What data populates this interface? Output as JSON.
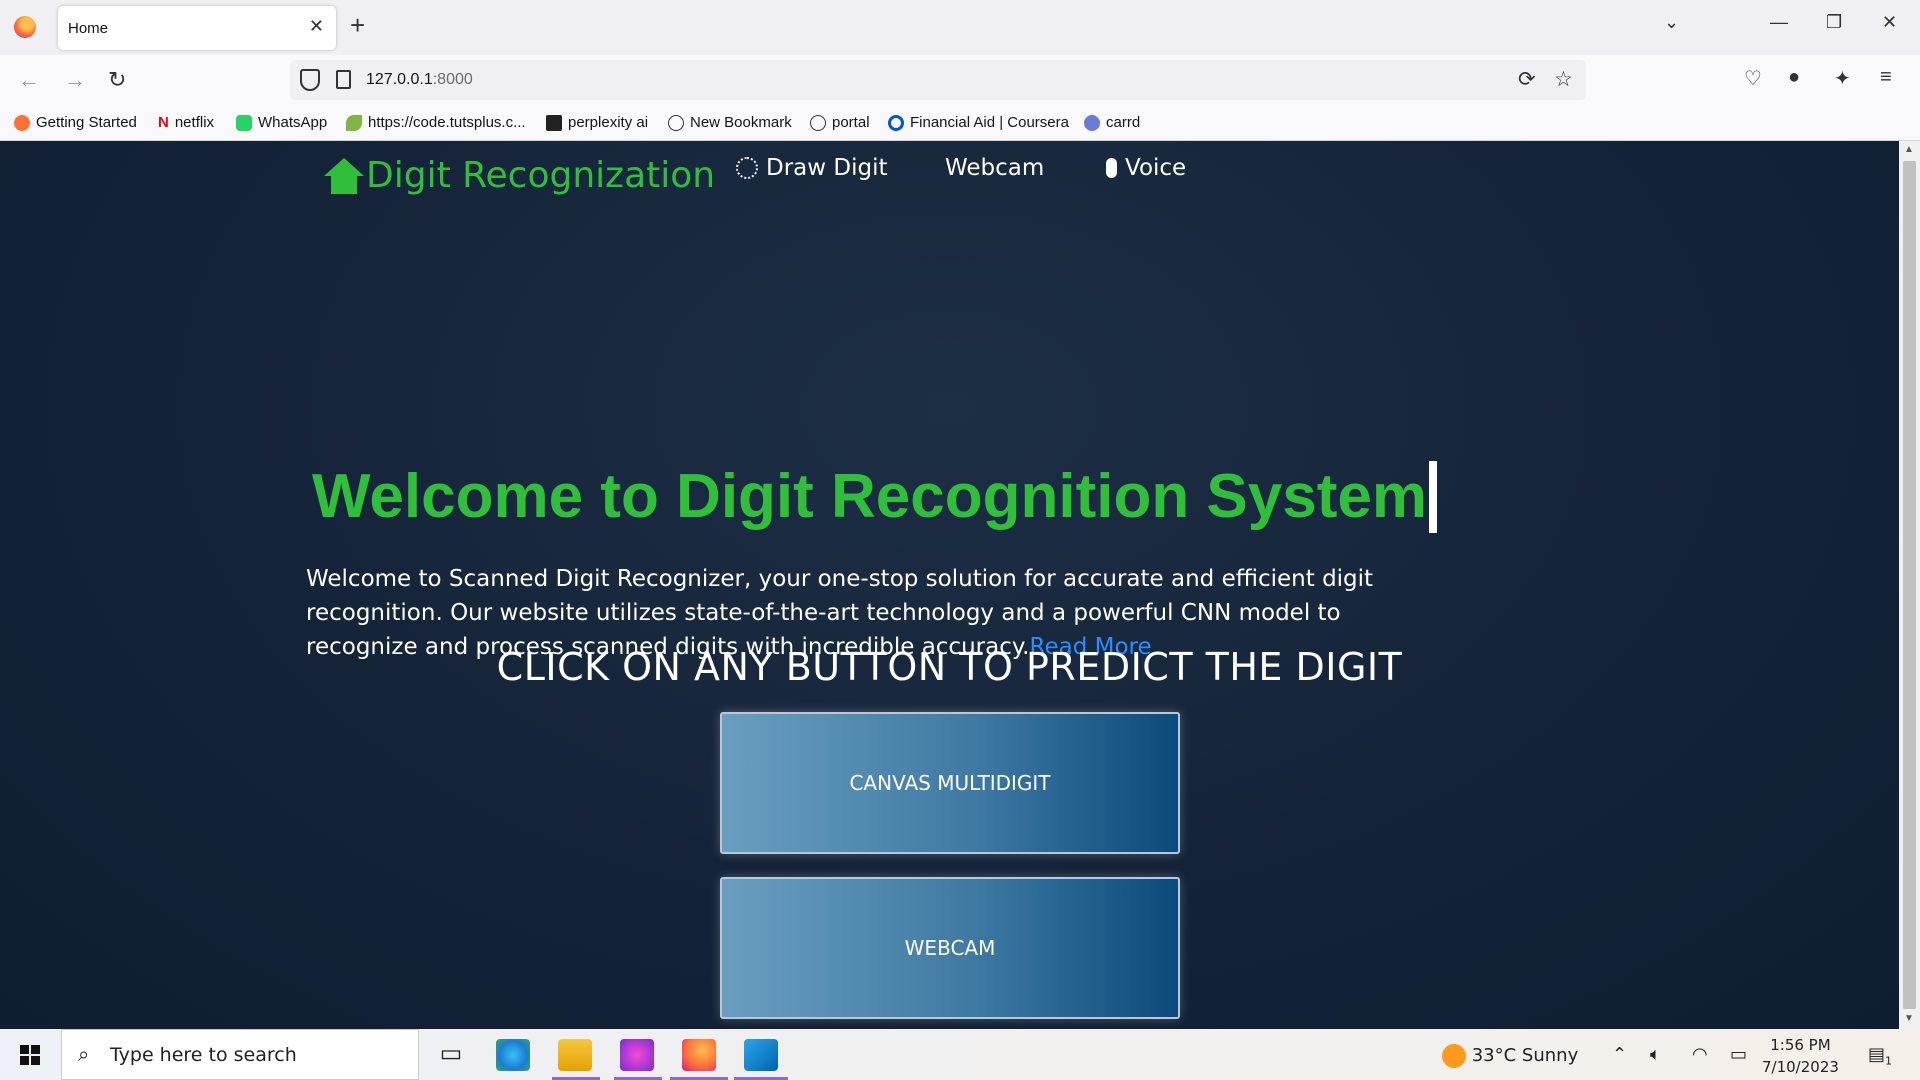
{
  "browser": {
    "tab_title": "Home",
    "url_host": "127.0.0.1",
    "url_port": ":8000",
    "bookmarks": [
      "Getting Started",
      "netflix",
      "WhatsApp",
      "https://code.tutsplus.c...",
      "perplexity ai",
      "New Bookmark",
      "portal",
      "Financial Aid | Coursera",
      "carrd"
    ]
  },
  "site": {
    "brand": "Digit Recognization",
    "nav": {
      "draw": "Draw Digit",
      "webcam": "Webcam",
      "voice": "Voice"
    },
    "hero_title": "Welcome to Digit Recognition System",
    "hero_text": "Welcome to Scanned Digit Recognizer, your one-stop solution for accurate and efficient digit recognition. Our website utilizes state-of-the-art technology and a powerful CNN model to recognize and process scanned digits with incredible accuracy.",
    "read_more": "Read More",
    "cta_heading": "CLICK ON ANY BUTTON TO PREDICT THE DIGIT",
    "buttons": [
      "CANVAS MULTIDIGIT",
      "WEBCAM"
    ]
  },
  "taskbar": {
    "search_placeholder": "Type here to search",
    "weather": "33°C  Sunny",
    "time": "1:56 PM",
    "date": "7/10/2023",
    "notification_count": "1"
  },
  "colors": {
    "accent_green": "#2fbf3a",
    "link_blue": "#2b8cff",
    "page_bg": "#142338"
  }
}
